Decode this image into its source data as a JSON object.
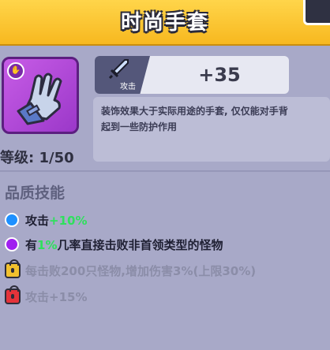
{
  "header": {
    "title": "时尚手套"
  },
  "item": {
    "level_text": "等级: 1/50",
    "rarity_color": "#b54be0"
  },
  "stat": {
    "label": "攻击",
    "value": "+35"
  },
  "description": "装饰效果大于实际用途的手套, 仅仅能对手背\n起到一些防护作用",
  "section": {
    "title": "品质技能"
  },
  "skills": [
    {
      "prefix": "攻击",
      "highlight": "+10%",
      "suffix": "",
      "icon": "blue-circle-icon",
      "color": "#1e90ff"
    },
    {
      "prefix": "有",
      "highlight": "1%",
      "suffix": "几率直接击败非首领类型的怪物",
      "icon": "purple-circle-icon",
      "color": "#a020f0"
    },
    {
      "text": "每击败200只怪物,增加伤害3%(上限30%)",
      "icon": "yellow-lock-icon",
      "color": "#f2c12e"
    },
    {
      "text": "攻击+15%",
      "icon": "red-lock-icon",
      "color": "#e5333a"
    }
  ]
}
